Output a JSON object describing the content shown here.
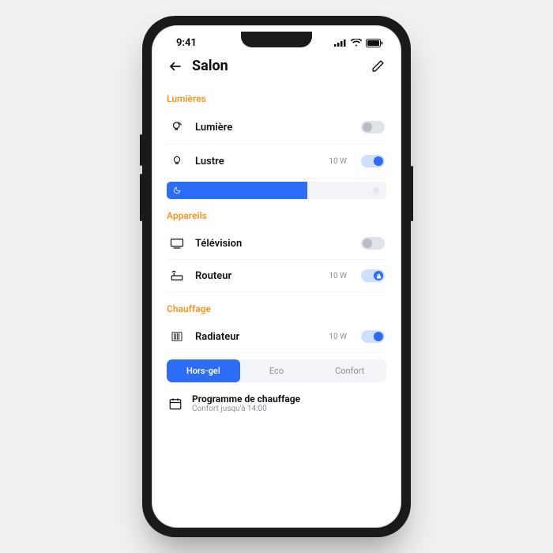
{
  "status": {
    "time": "9:41"
  },
  "header": {
    "title": "Salon"
  },
  "sections": {
    "lights": {
      "title": "Lumières",
      "items": [
        {
          "label": "Lumière",
          "power": "",
          "on": false
        },
        {
          "label": "Lustre",
          "power": "10 W",
          "on": true
        }
      ]
    },
    "devices": {
      "title": "Appareils",
      "items": [
        {
          "label": "Télévision",
          "power": "",
          "on": false
        },
        {
          "label": "Routeur",
          "power": "10 W",
          "on": true,
          "locked": true
        }
      ]
    },
    "heating": {
      "title": "Chauffage",
      "items": [
        {
          "label": "Radiateur",
          "power": "10 W",
          "on": true
        }
      ],
      "modes": {
        "active": "Hors-gel",
        "a": "Hors-gel",
        "b": "Eco",
        "c": "Confort"
      },
      "program": {
        "title": "Programme de chauffage",
        "sub": "Confort jusqu'à 14:00"
      }
    }
  }
}
